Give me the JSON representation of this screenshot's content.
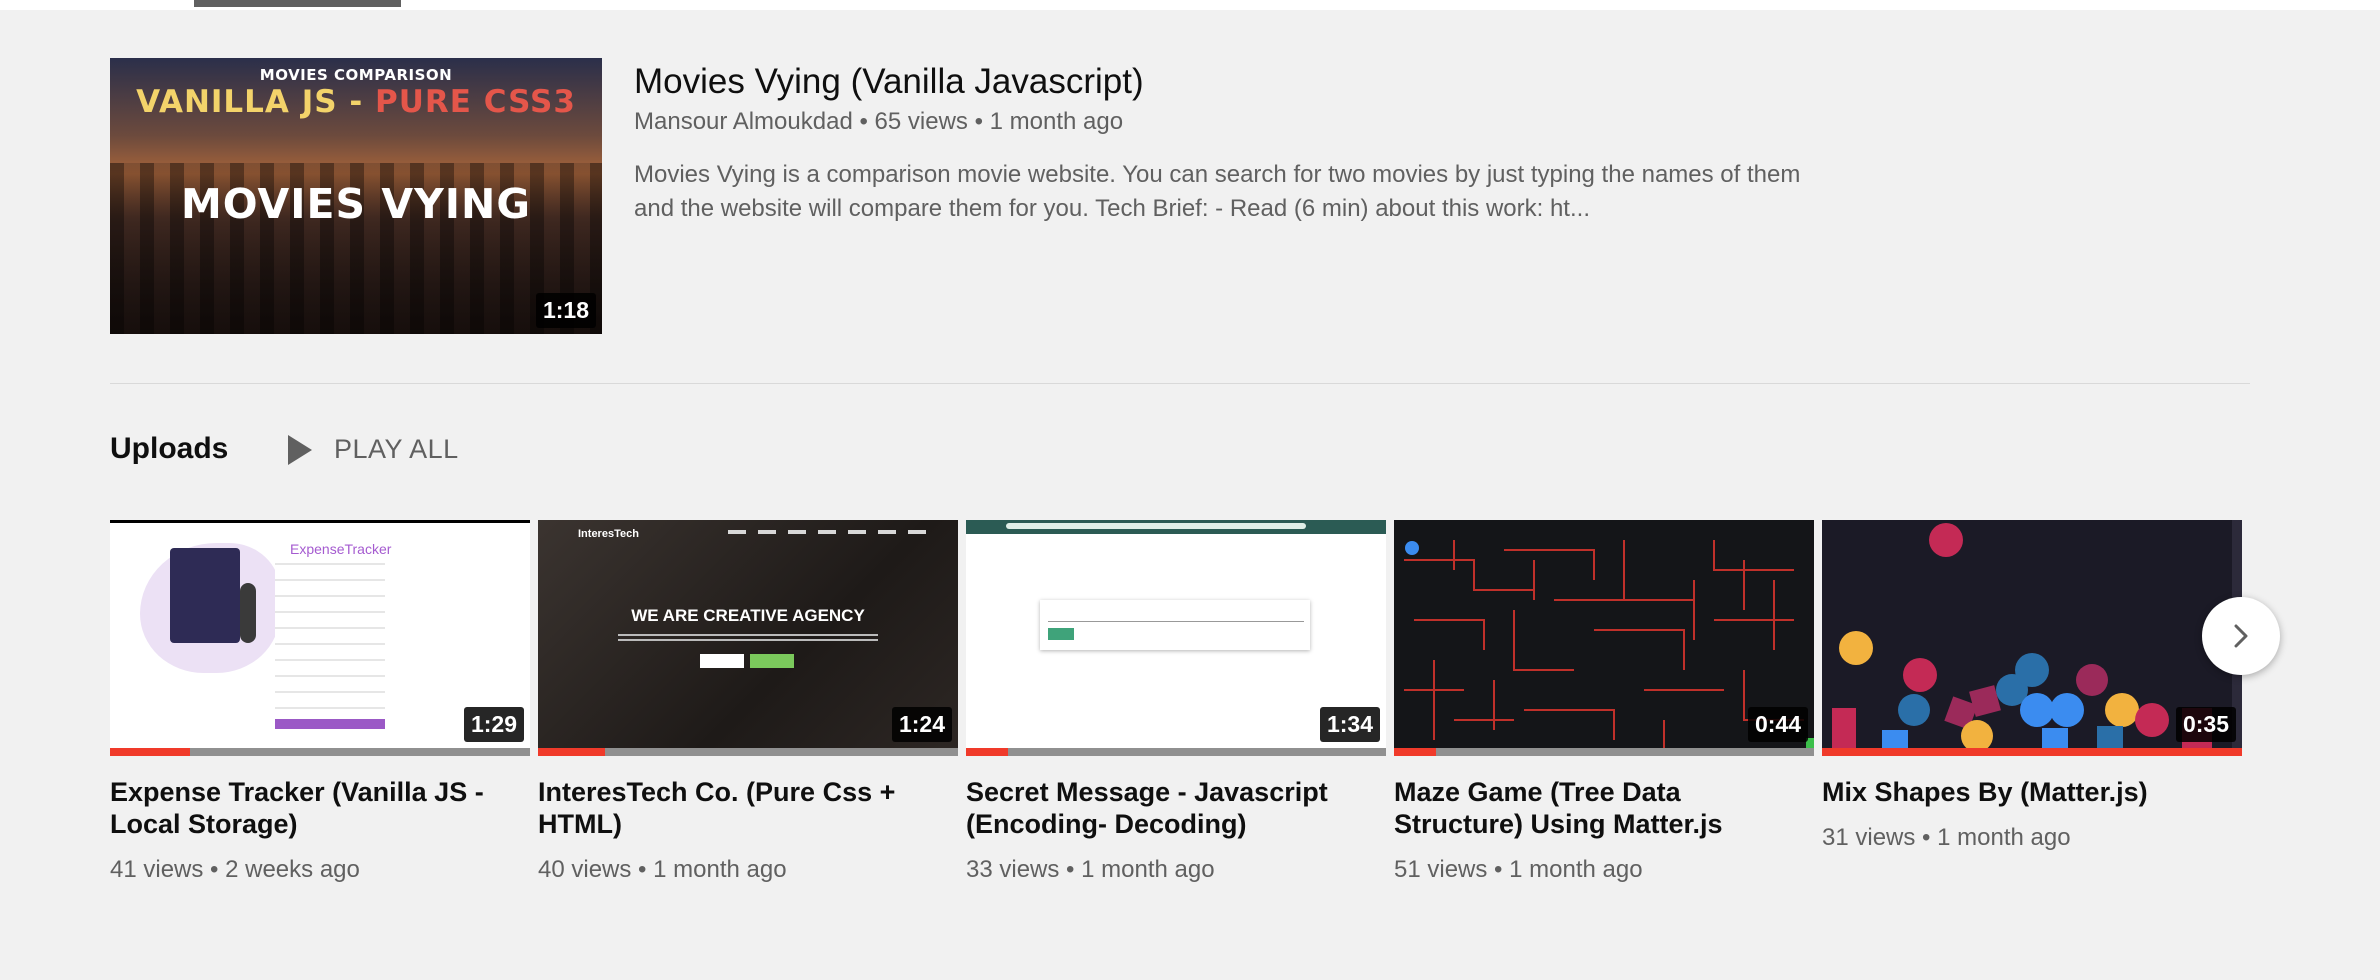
{
  "featured": {
    "title": "Movies Vying (Vanilla Javascript)",
    "meta": "Mansour Almoukdad • 65 views • 1 month ago",
    "description": "Movies Vying is a comparison movie website. You can search for two movies by just typing the names of them and the website will compare them for you. Tech Brief: - Read (6 min) about this work: ht...",
    "duration": "1:18",
    "thumb": {
      "top_text": "MOVIES COMPARISON",
      "line2_left": "VANILLA JS - ",
      "line2_right": "PURE CSS3",
      "big_text": "MOVIES VYING"
    }
  },
  "uploads": {
    "section_title": "Uploads",
    "play_all_label": "PLAY ALL",
    "items": [
      {
        "title": "Expense Tracker (Vanilla JS - Local Storage)",
        "meta": "41 views • 2 weeks ago",
        "duration": "1:29",
        "watched_fraction": 0.19,
        "thumb_text": "ExpenseTracker"
      },
      {
        "title": "InteresTech Co. (Pure Css + HTML)",
        "meta": "40 views • 1 month ago",
        "duration": "1:24",
        "watched_fraction": 0.16,
        "thumb_brand": "InteresTech",
        "thumb_headline": "WE ARE CREATIVE AGENCY"
      },
      {
        "title": "Secret Message - Javascript (Encoding- Decoding)",
        "meta": "33 views • 1 month ago",
        "duration": "1:34",
        "watched_fraction": 0.1
      },
      {
        "title": "Maze Game (Tree Data Structure) Using Matter.js",
        "meta": "51 views • 1 month ago",
        "duration": "0:44",
        "watched_fraction": 0.1
      },
      {
        "title": "Mix Shapes By (Matter.js)",
        "meta": "31 views • 1 month ago",
        "duration": "0:35",
        "watched_fraction": 1.0
      }
    ]
  },
  "icons": {
    "play": "play-icon",
    "next": "chevron-right-icon"
  },
  "colors": {
    "progress_red": "#f03a2a",
    "meta_gray": "#606060",
    "background": "#f1f1f1"
  }
}
